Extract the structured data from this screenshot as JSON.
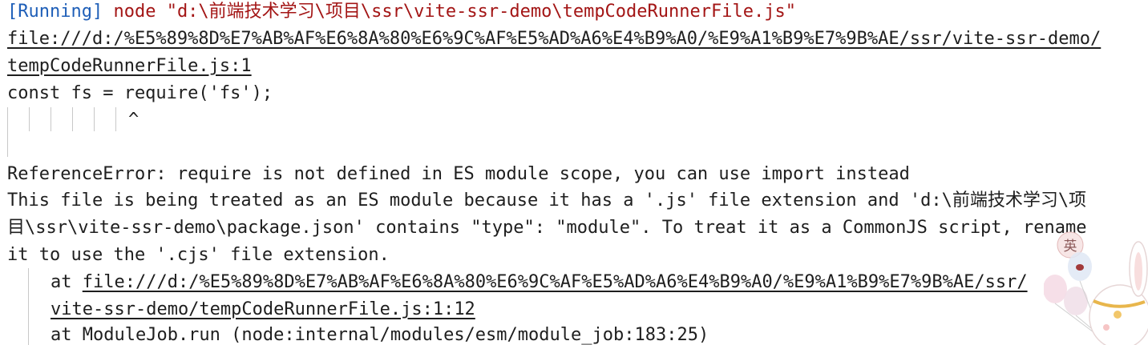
{
  "output": {
    "run_status": "[Running]",
    "run_command": "node \"d:\\前端技术学习\\项目\\ssr\\vite-ssr-demo\\tempCodeRunnerFile.js\"",
    "file_url_part1": "file:///d:/%E5%89%8D%E7%AB%AF%E6%8A%80%E6%9C%AF%E5%AD%A6%E4%B9%A0/%E9%A1%B9%E7%9B%AE/ssr/vite-ssr-demo/",
    "file_url_part2": "tempCodeRunnerFile.js:1",
    "source_line": "const fs = require('fs');",
    "caret": "^",
    "error_message": "ReferenceError: require is not defined in ES module scope, you can use import instead",
    "explain_line1": "This file is being treated as an ES module because it has a '.js' file extension and 'd:\\前端技术学习\\项",
    "explain_line2": "目\\ssr\\vite-ssr-demo\\package.json' contains \"type\": \"module\". To treat it as a CommonJS script, rename",
    "explain_line3": "it to use the '.cjs' file extension.",
    "stack": [
      {
        "prefix": "at ",
        "link_part1": "file:///d:/%E5%89%8D%E7%AB%AF%E6%8A%80%E6%9C%AF%E5%AD%A6%E4%B9%A0/%E9%A1%B9%E7%9B%AE/ssr/",
        "link_part2": "vite-ssr-demo/tempCodeRunnerFile.js:1:12"
      },
      {
        "text": "at ModuleJob.run (node:internal/modules/esm/module_job:183:25)"
      }
    ]
  },
  "ime_badge": "英",
  "colors": {
    "running": "#1f5fb8",
    "command": "#a31515",
    "text": "#1e1e1e",
    "guide": "#c8c8c8"
  }
}
